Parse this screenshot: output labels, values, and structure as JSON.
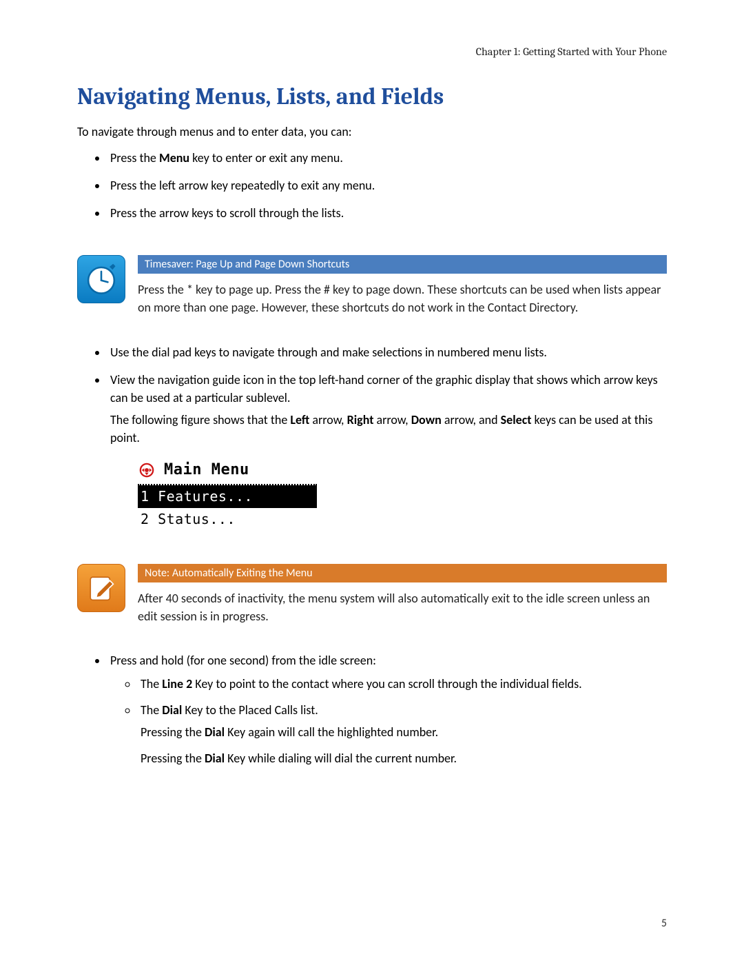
{
  "header": {
    "chapter_line": "Chapter 1: Getting Started with Your Phone"
  },
  "page_number": "5",
  "section": {
    "title": "Navigating Menus, Lists, and Fields",
    "intro": "To navigate through menus and to enter data, you can:",
    "bullets_1": {
      "b0_pre": "Press the ",
      "b0_bold": "Menu",
      "b0_post": " key to enter or exit any menu.",
      "b1": "Press the left arrow key repeatedly to exit any menu.",
      "b2": "Press the arrow keys to scroll through the lists."
    },
    "timesaver": {
      "title": "Timesaver: Page Up and Page Down Shortcuts",
      "body": "Press the * key to page up. Press the # key to page down. These shortcuts can be used when lists appear on more than one page. However, these shortcuts do not work in the Contact Directory."
    },
    "bullets_2": {
      "b0": "Use the dial pad keys to navigate through and make selections in numbered menu lists.",
      "b1": "View the navigation guide icon in the top left-hand corner of the graphic display that shows which arrow keys can be used at a particular sublevel.",
      "b1_follow_pre": "The following figure shows that the ",
      "b1_follow_k1": "Left",
      "b1_follow_m1": " arrow, ",
      "b1_follow_k2": "Right",
      "b1_follow_m2": " arrow, ",
      "b1_follow_k3": "Down",
      "b1_follow_m3": " arrow, and ",
      "b1_follow_k4": "Select",
      "b1_follow_post": " keys can be used at this point."
    },
    "phone_display": {
      "title": "Main Menu",
      "row1": "1 Features...",
      "row2": "2 Status..."
    },
    "note": {
      "title": "Note: Automatically Exiting the Menu",
      "body": "After 40 seconds of inactivity, the menu system will also automatically exit to the idle screen unless an edit session is in progress."
    },
    "bullets_3": {
      "b0": "Press and hold (for one second) from the idle screen:",
      "sub": {
        "s0_pre": "The ",
        "s0_bold": "Line 2",
        "s0_post": " Key to point to the contact where you can scroll through the individual fields.",
        "s1_pre": "The ",
        "s1_bold": "Dial",
        "s1_post": " Key to the Placed Calls list.",
        "s1_p2_pre": "Pressing the ",
        "s1_p2_bold": "Dial",
        "s1_p2_post": " Key again will call the highlighted number.",
        "s1_p3_pre": "Pressing the ",
        "s1_p3_bold": "Dial",
        "s1_p3_post": " Key while dialing will dial the current number."
      }
    }
  }
}
